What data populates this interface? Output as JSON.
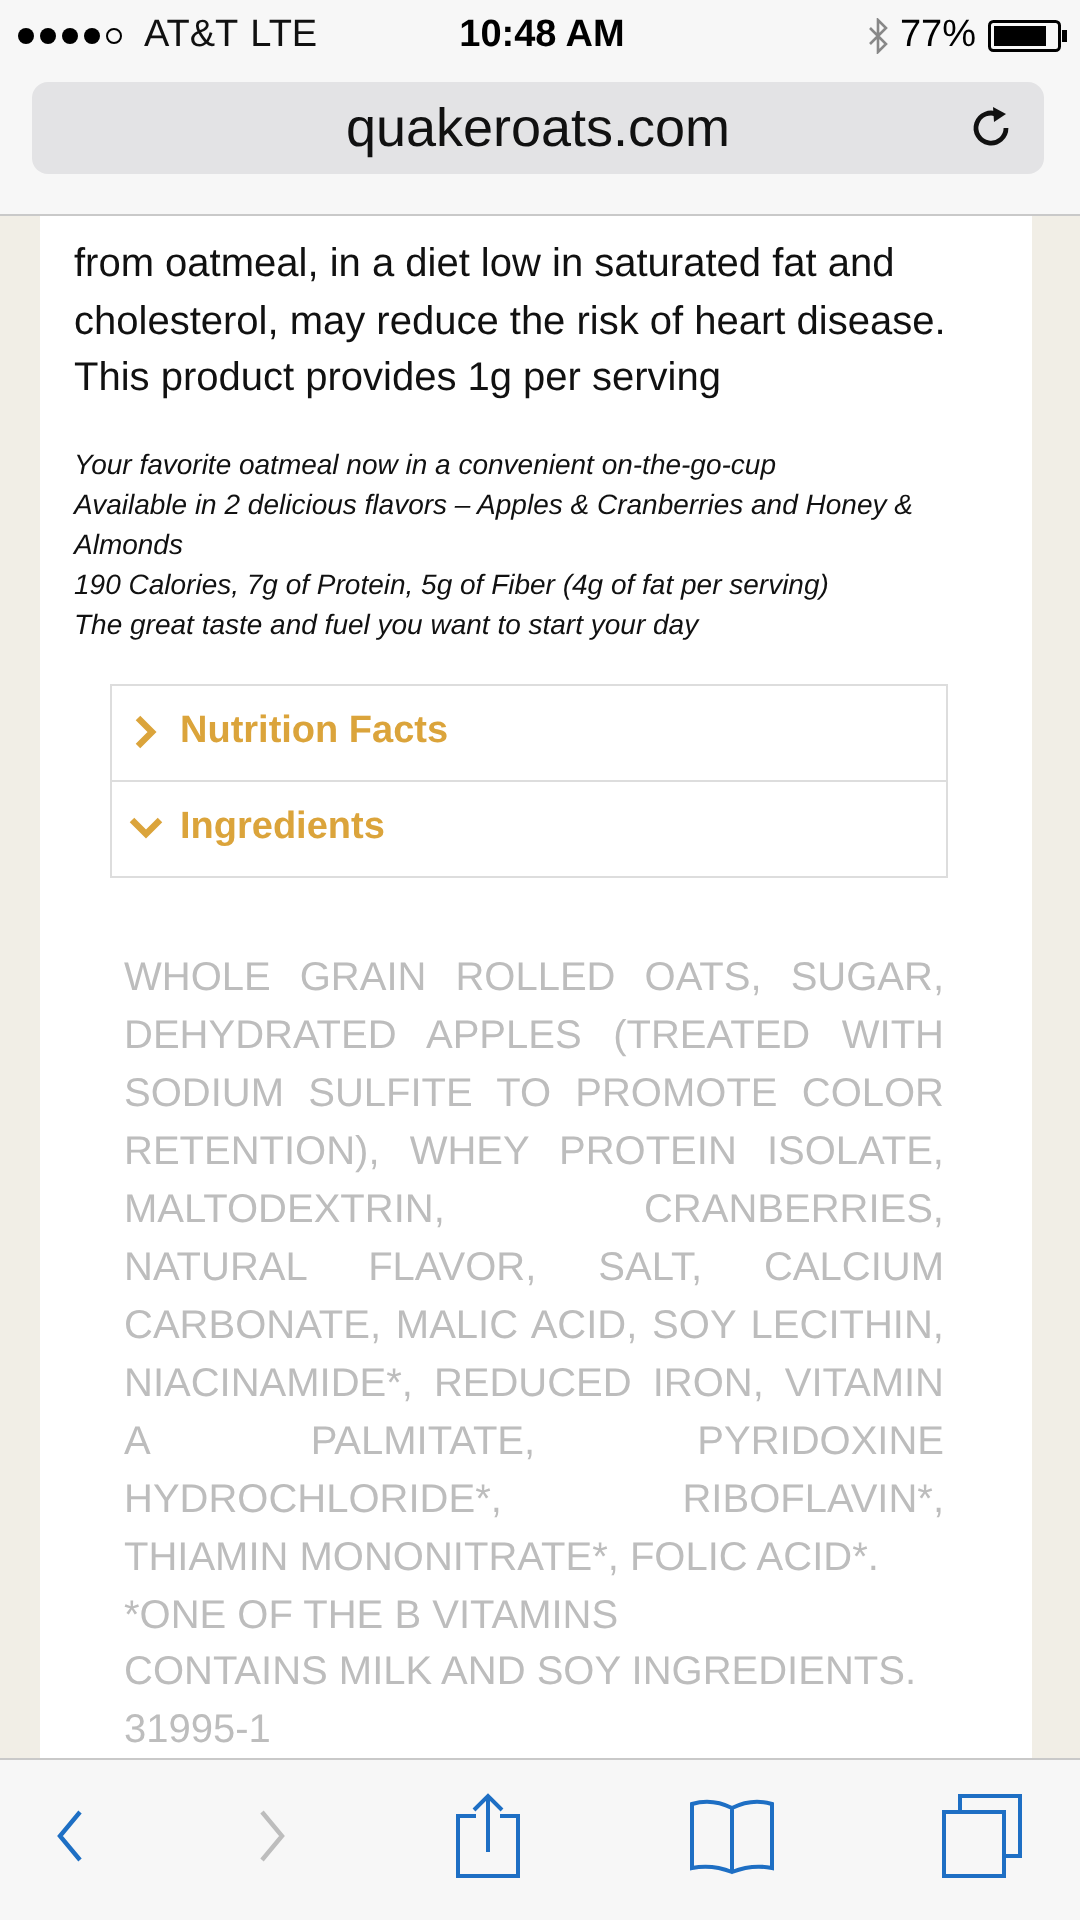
{
  "status_bar": {
    "carrier": "AT&T",
    "network": "LTE",
    "time": "10:48 AM",
    "battery": "77%"
  },
  "address_bar": {
    "url": "quakeroats.com"
  },
  "intro": "from oatmeal, in a diet low in saturated fat and cholesterol, may reduce the risk of heart disease. This product provides 1g per serving",
  "features": [
    "Your favorite oatmeal now in a convenient on-the-go-cup",
    "Available in 2 delicious flavors – Apples & Cranberries and Honey & Almonds",
    "190 Calories, 7g of Protein, 5g of Fiber (4g of fat per serving)",
    "The great taste and fuel you want to start your day"
  ],
  "accordion": [
    {
      "label": "Nutrition Facts",
      "expanded": false
    },
    {
      "label": "Ingredients",
      "expanded": true
    }
  ],
  "ingredients": {
    "text": "WHOLE GRAIN ROLLED OATS, SUGAR, DEHYDRATED APPLES (TREATED WITH SODIUM SULFITE TO PROMOTE COLOR RETENTION), WHEY PROTEIN ISOLATE, MALTODEXTRIN, CRANBERRIES, NATURAL FLAVOR, SALT, CALCIUM CARBONATE, MALIC ACID, SOY LECITHIN, NIACINAMIDE*, REDUCED IRON, VITAMIN A PALMITATE, PYRIDOXINE HYDROCHLORIDE*, RIBOFLAVIN*, THIAMIN MONONITRATE*, FOLIC ACID*.",
    "notes": [
      "*ONE OF THE B VITAMINS",
      "CONTAINS MILK AND SOY INGREDIENTS.",
      "31995-1"
    ]
  },
  "toolbar": [
    {
      "kind": "back",
      "disabled": false
    },
    {
      "kind": "forward",
      "disabled": true
    },
    {
      "kind": "share",
      "disabled": false
    },
    {
      "kind": "bookmarks",
      "disabled": false
    },
    {
      "kind": "tabs",
      "disabled": false
    }
  ]
}
